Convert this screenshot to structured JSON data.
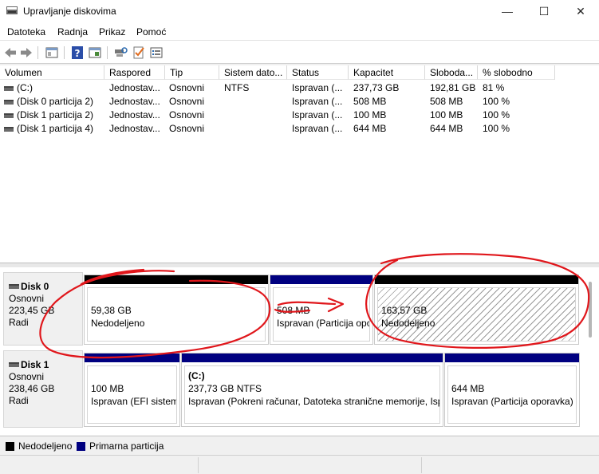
{
  "window": {
    "title": "Upravljanje diskovima",
    "minimize": "—",
    "maximize": "☐",
    "close": "✕"
  },
  "menu": [
    "Datoteka",
    "Radnja",
    "Prikaz",
    "Pomoć"
  ],
  "volumes": {
    "columns": [
      "Volumen",
      "Raspored",
      "Tip",
      "Sistem dato...",
      "Status",
      "Kapacitet",
      "Sloboda...",
      "% slobodno"
    ],
    "rows": [
      [
        "(C:)",
        "Jednostav...",
        "Osnovni",
        "NTFS",
        "Ispravan (...",
        "237,73 GB",
        "192,81 GB",
        "81 %"
      ],
      [
        "(Disk 0 particija 2)",
        "Jednostav...",
        "Osnovni",
        "",
        "Ispravan (...",
        "508 MB",
        "508 MB",
        "100 %"
      ],
      [
        "(Disk 1 particija 2)",
        "Jednostav...",
        "Osnovni",
        "",
        "Ispravan (...",
        "100 MB",
        "100 MB",
        "100 %"
      ],
      [
        "(Disk 1 particija 4)",
        "Jednostav...",
        "Osnovni",
        "",
        "Ispravan (...",
        "644 MB",
        "644 MB",
        "100 %"
      ]
    ]
  },
  "disks": [
    {
      "name": "Disk 0",
      "type": "Osnovni",
      "size": "223,45 GB",
      "state": "Radi",
      "partitions": [
        {
          "title": "",
          "size": "59,38 GB",
          "status": "Nedodeljeno",
          "kind": "unallocated"
        },
        {
          "title": "",
          "size": "508 MB",
          "status": "Ispravan (Particija opo",
          "kind": "primary"
        },
        {
          "title": "",
          "size": "163,57 GB",
          "status": "Nedodeljeno",
          "kind": "unallocated"
        }
      ]
    },
    {
      "name": "Disk 1",
      "type": "Osnovni",
      "size": "238,46 GB",
      "state": "Radi",
      "partitions": [
        {
          "title": "",
          "size": "100 MB",
          "status": "Ispravan (EFI sistems",
          "kind": "primary"
        },
        {
          "title": "(C:)",
          "size": "237,73 GB NTFS",
          "status": "Ispravan (Pokreni računar, Datoteka stranične memorije, Isp",
          "kind": "primary"
        },
        {
          "title": "",
          "size": "644 MB",
          "status": "Ispravan (Particija oporavka)",
          "kind": "primary"
        }
      ]
    }
  ],
  "legend": [
    {
      "label": "Nedodeljeno",
      "color": "#000000"
    },
    {
      "label": "Primarna particija",
      "color": "#000080"
    }
  ],
  "colors": {
    "primary": "#000080",
    "unallocated": "#000000",
    "annotation": "#e0161b"
  }
}
